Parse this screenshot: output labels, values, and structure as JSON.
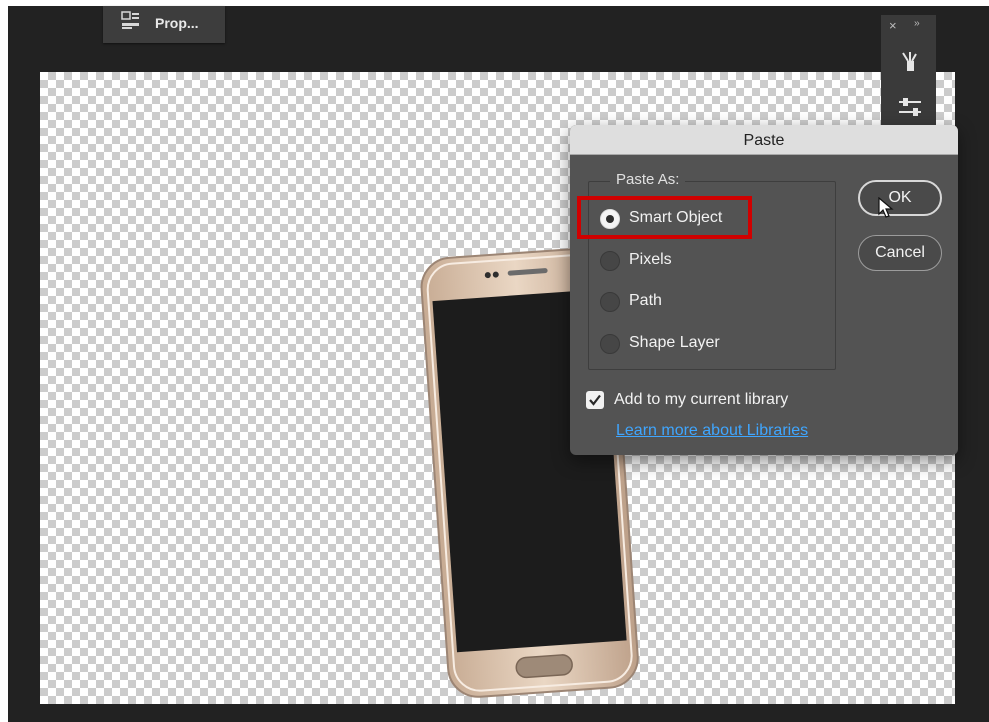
{
  "properties_panel": {
    "label": "Prop...",
    "icon": "properties-icon"
  },
  "right_panel": {
    "close_glyph": "×",
    "collapse_glyph": "››",
    "icons": [
      "brush-icon",
      "adjustments-sliders-icon"
    ]
  },
  "dialog": {
    "title": "Paste",
    "group_label": "Paste As:",
    "options": [
      {
        "label": "Smart Object",
        "selected": true
      },
      {
        "label": "Pixels",
        "selected": false
      },
      {
        "label": "Path",
        "selected": false
      },
      {
        "label": "Shape Layer",
        "selected": false
      }
    ],
    "ok_label": "OK",
    "cancel_label": "Cancel",
    "library_checkbox_label": "Add to my current library",
    "library_checked": true,
    "learn_more_link": "Learn more about Libraries"
  },
  "colors": {
    "highlight": "#d00000",
    "link": "#3fa6ff",
    "dialog_bg": "#535353",
    "workspace_bg": "#222222"
  }
}
